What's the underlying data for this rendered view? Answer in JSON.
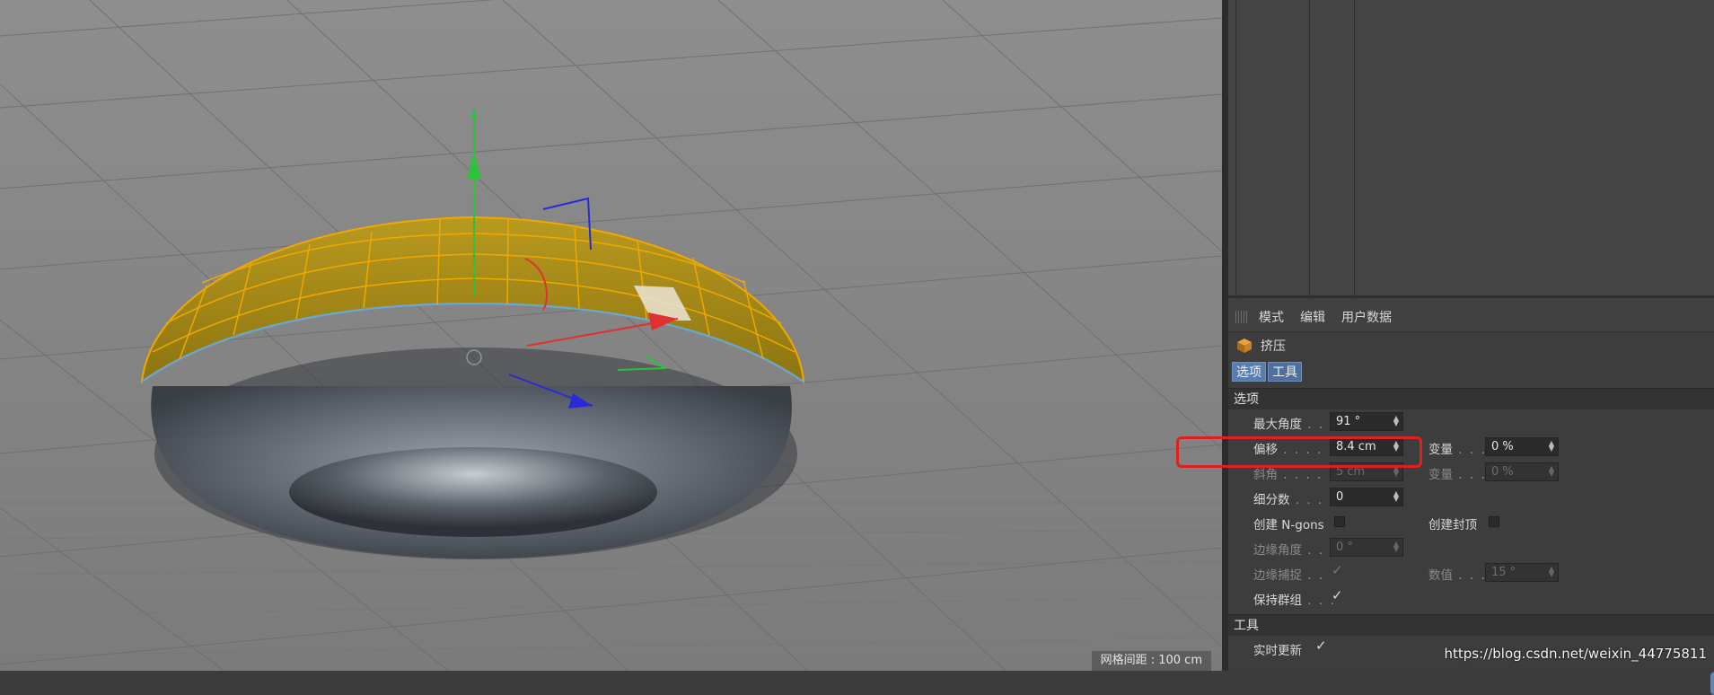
{
  "viewport": {
    "status": "网格间距 : 100 cm"
  },
  "attributes": {
    "menu": [
      "模式",
      "编辑",
      "用户数据"
    ],
    "tool_name": "挤压",
    "tabs": [
      "选项",
      "工具"
    ],
    "section_options": "选项",
    "rows": {
      "max_angle": {
        "label": "最大角度",
        "value": "91 °"
      },
      "offset": {
        "label": "偏移",
        "value": "8.4 cm",
        "var_label": "变量",
        "var_value": "0 %"
      },
      "bevel": {
        "label": "斜角",
        "value": "5 cm",
        "var_label": "变量",
        "var_value": "0 %"
      },
      "subdivision": {
        "label": "细分数",
        "value": "0"
      },
      "create_ngons": {
        "label": "创建 N-gons",
        "cap_label": "创建封顶"
      },
      "edge_angle": {
        "label": "边缘角度",
        "value": "0 °"
      },
      "edge_snap": {
        "label": "边缘捕捉",
        "num_label": "数值",
        "num_value": "15 °"
      },
      "keep_groups": {
        "label": "保持群组"
      }
    },
    "section_tool": "工具",
    "realtime_label": "实时更新"
  },
  "watermark": "https://blog.csdn.net/weixin_44775811",
  "colors": {
    "selection_yellow": "#c9a200",
    "axis_y": "#2ec13a",
    "axis_x": "#e03030",
    "axis_z": "#2a2ad8",
    "highlight_box": "#e0201e",
    "tab_blue": "#5a7db0"
  }
}
